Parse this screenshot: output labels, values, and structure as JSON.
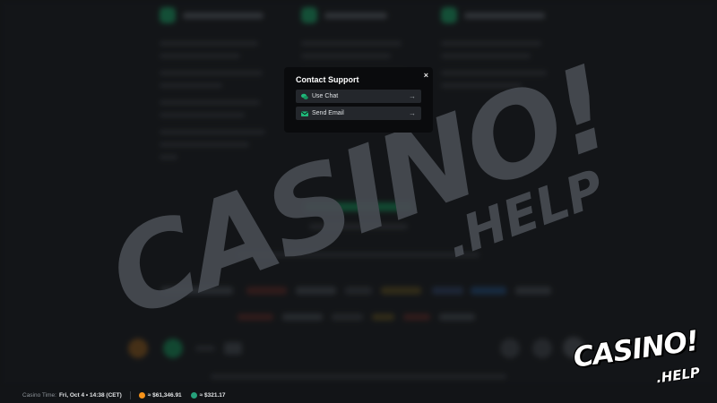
{
  "modal": {
    "title": "Contact Support",
    "close": "×",
    "options": [
      {
        "label": "Use Chat",
        "icon": "chat-bubbles-icon",
        "arrow": "→"
      },
      {
        "label": "Send Email",
        "icon": "envelope-icon",
        "arrow": "→"
      }
    ]
  },
  "statusbar": {
    "time_label": "Casino Time:",
    "time_value": "Fri, Oct 4 • 14:38 (CET)",
    "balances": [
      {
        "coin_icon": "bitcoin-icon",
        "coin_color": "#f7931a",
        "value": "≈ $61,346.91"
      },
      {
        "coin_icon": "tether-icon",
        "coin_color": "#26a17b",
        "value": "≈ $321.17"
      }
    ]
  },
  "watermark": {
    "main": "CASINO!",
    "sub": ".HELP"
  },
  "logo": {
    "main": "CASINO!",
    "sub": ".HELP"
  },
  "colors": {
    "accent": "#1fb87a",
    "modal_bg": "#0a0b0d",
    "page_bg": "#1e2125"
  }
}
